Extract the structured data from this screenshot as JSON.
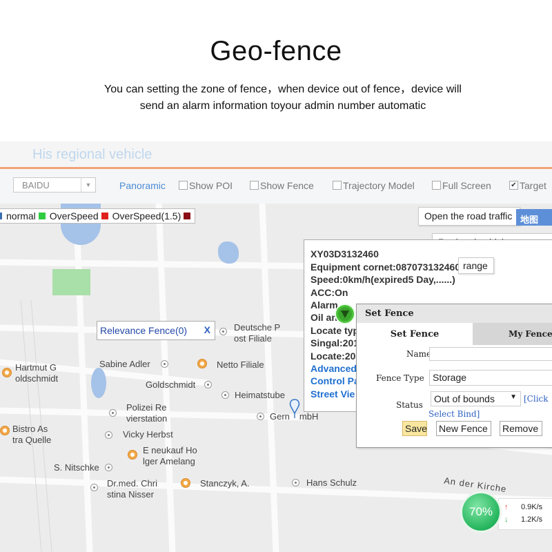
{
  "header": {
    "title": "Geo-fence",
    "desc_line1": "You can setting the zone of fence，when device out of fence，device will",
    "desc_line2": "send an alarm information toyour admin number automatic"
  },
  "app": {
    "title": "His regional vehicle",
    "toolbar": {
      "map_select": "BAIDU",
      "panoramic": "Panoramic",
      "show_poi": "Show POI",
      "show_fence": "Show Fence",
      "trajectory_model": "Trajectory Model",
      "full_screen": "Full Screen",
      "target": "Target",
      "target_checked": true
    },
    "legend": [
      {
        "label": "normal",
        "color": "#2ecc40"
      },
      {
        "label": "OverSpeed",
        "color": "#e0201c"
      },
      {
        "label": "OverSpeed(1.5)",
        "color": "#8b0d16"
      }
    ],
    "legend_lead_color": "#3d6fb0",
    "buttons": {
      "traffic": "Open the road traffic",
      "basemap": "地图",
      "regional": "Regional vehicle",
      "range": "range"
    },
    "relevance_fence": {
      "label": "Relevance Fence(0)",
      "close": "X"
    },
    "pois": {
      "deutsche_post_1": "Deutsche P",
      "deutsche_post_2": "ost Filiale",
      "hartmut_1": "Hartmut G",
      "hartmut_2": "oldschmidt",
      "sabine_adler": "Sabine Adler",
      "netto": "Netto Filiale",
      "goldschmidt": "Goldschmidt",
      "heimatstube": "Heimatstube",
      "polizei_1": "Polizei Re",
      "polizei_2": "vierstation",
      "gern": "Gern",
      "gern_tail": "mbH",
      "bistro_1": "Bistro As",
      "bistro_2": "tra Quelle",
      "vicky": "Vicky Herbst",
      "eneukauf_1": "E neukauf Ho",
      "eneukauf_2": "lger Amelang",
      "nitschke": "S. Nitschke",
      "drmed_1": "Dr.med. Chri",
      "drmed_2": "stina Nisser",
      "stanczyk": "Stanczyk, A.",
      "hans": "Hans Schulz",
      "street": "An der Kirche"
    },
    "info_window": {
      "device_id": "XY03D3132460",
      "equipment": "Equipment cornet:087073132460",
      "speed": "Speed:0km/h(expired5 Day,......)",
      "acc": "ACC:On",
      "alarm": "Alarm",
      "oil": "Oil an",
      "locate_type": "Locate typ",
      "signal": "Singal:201",
      "locate": "Locate:201",
      "advanced": "Advanced",
      "control": "Control Pa",
      "street_view": "Street Vie"
    },
    "set_fence": {
      "title": "Set Fence",
      "tab_set": "Set Fence",
      "tab_my": "My Fence",
      "name_label": "Name",
      "name_value": "",
      "type_label": "Fence Type",
      "type_value": "Storage",
      "status_label": "Status",
      "status_value": "Out of bounds",
      "click_link": "[Click",
      "select_bind": "Select Bind]",
      "save": "Save",
      "new_fence": "New Fence",
      "remove": "Remove"
    },
    "network": {
      "percent": "70%",
      "up": "0.9K/s",
      "down": "1.2K/s"
    }
  }
}
